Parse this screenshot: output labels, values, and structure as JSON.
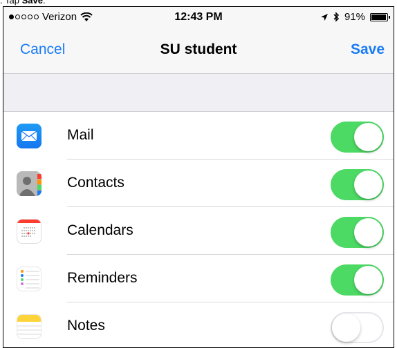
{
  "caption": {
    "text": ". Tap ",
    "bold": "Save",
    "end": "."
  },
  "status_bar": {
    "carrier": "Verizon",
    "time": "12:43 PM",
    "battery": "91%",
    "signal_bars": 1,
    "battery_level": 0.91
  },
  "nav": {
    "cancel_label": "Cancel",
    "title": "SU student",
    "save_label": "Save"
  },
  "accent_color": "#1a7cf5",
  "toggle_on_color": "#4cd964",
  "items": [
    {
      "label": "Mail",
      "enabled": true,
      "icon": "mail-icon"
    },
    {
      "label": "Contacts",
      "enabled": true,
      "icon": "contacts-icon"
    },
    {
      "label": "Calendars",
      "enabled": true,
      "icon": "calendars-icon"
    },
    {
      "label": "Reminders",
      "enabled": true,
      "icon": "reminders-icon"
    },
    {
      "label": "Notes",
      "enabled": false,
      "icon": "notes-icon"
    }
  ]
}
